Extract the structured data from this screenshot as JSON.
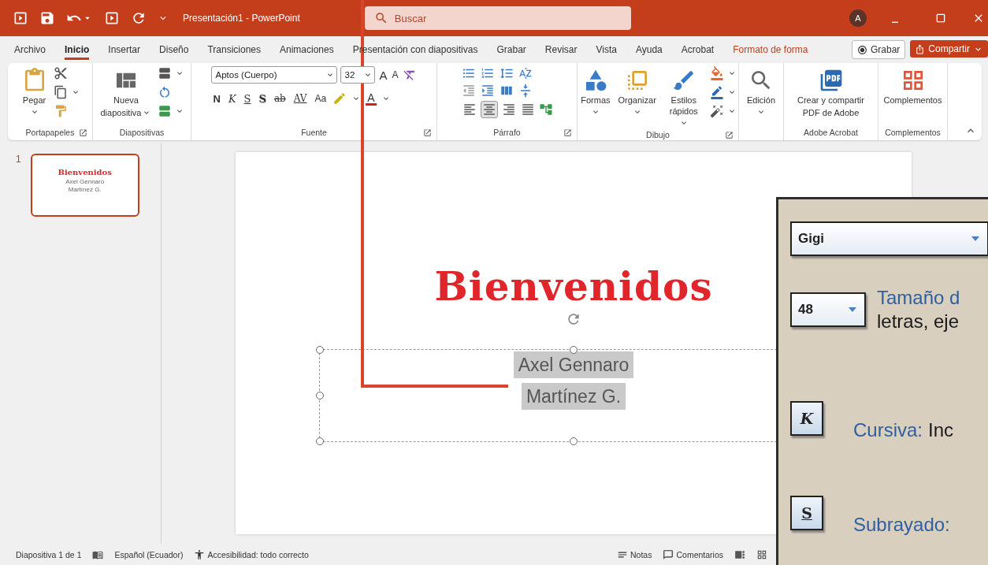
{
  "title_bar": {
    "title": "Presentación1 - PowerPoint",
    "search": {
      "placeholder": "Buscar"
    },
    "avatar": "A"
  },
  "menu_tabs": [
    {
      "label": "Archivo",
      "selected": false,
      "contextual": false
    },
    {
      "label": "Inicio",
      "selected": true,
      "contextual": false
    },
    {
      "label": "Insertar",
      "selected": false,
      "contextual": false
    },
    {
      "label": "Diseño",
      "selected": false,
      "contextual": false
    },
    {
      "label": "Transiciones",
      "selected": false,
      "contextual": false
    },
    {
      "label": "Animaciones",
      "selected": false,
      "contextual": false
    },
    {
      "label": "Presentación con diapositivas",
      "selected": false,
      "contextual": false
    },
    {
      "label": "Grabar",
      "selected": false,
      "contextual": false
    },
    {
      "label": "Revisar",
      "selected": false,
      "contextual": false
    },
    {
      "label": "Vista",
      "selected": false,
      "contextual": false
    },
    {
      "label": "Ayuda",
      "selected": false,
      "contextual": false
    },
    {
      "label": "Acrobat",
      "selected": false,
      "contextual": false
    },
    {
      "label": "Formato de forma",
      "selected": false,
      "contextual": true
    }
  ],
  "tab_actions": [
    {
      "kind": "outline",
      "label": "Grabar"
    },
    {
      "kind": "primary",
      "label": "Compartir"
    }
  ],
  "ribbon": [
    {
      "kind": "clipboard",
      "label": "Portapapeles",
      "launcher": true,
      "button": "Pegar"
    },
    {
      "kind": "slides",
      "label": "Diapositivas",
      "button_lines": [
        "Nueva",
        "diapositiva"
      ]
    },
    {
      "kind": "font",
      "label": "Fuente",
      "launcher": true,
      "font": "Aptos (Cuerpo)",
      "size": "32",
      "grow": "A",
      "shrink": "A",
      "format_buttons": [
        "N",
        "K",
        "S",
        "S",
        "ab",
        "AV",
        "Aa"
      ],
      "color_button": "A"
    },
    {
      "kind": "paragraph",
      "label": "Párrafo",
      "launcher": true,
      "align_buttons": [
        {
          "selected": false
        },
        {
          "selected": true
        },
        {
          "selected": false
        },
        {
          "selected": false
        }
      ]
    },
    {
      "kind": "drawing",
      "label": "Dibujo",
      "launcher": true,
      "buttons": [
        "Formas",
        "Organizar",
        "Estilos rápidos"
      ]
    },
    {
      "kind": "editing",
      "button": "Edición"
    },
    {
      "kind": "acrobat",
      "label": "Adobe Acrobat",
      "button_lines": [
        "Crear y compartir",
        "PDF de Adobe"
      ]
    },
    {
      "kind": "addins",
      "label": "Complementos",
      "button": "Complementos"
    }
  ],
  "thumbnails": [
    {
      "number": "1",
      "selected": true,
      "title": "Bienvenidos",
      "subtitle_lines": [
        "Axel Gennaro",
        "Martínez G."
      ]
    }
  ],
  "slide": {
    "title": "Bienvenidos",
    "subtitle": {
      "lines": [
        "Axel Gennaro",
        "Martínez G."
      ],
      "selected": true,
      "text_highlighted": true
    }
  },
  "status_bar": {
    "slide": "Diapositiva 1 de 1",
    "language": "Español (Ecuador)",
    "accessibility": "Accesibilidad: todo correcto",
    "notes": "Notas",
    "comments": "Comentarios"
  },
  "overlay_panel": {
    "rows": [
      {
        "kind": "font_box",
        "value": "Gigi"
      },
      {
        "kind": "size_box",
        "value": "48",
        "term": "Tamaño d",
        "desc": "letras, eje"
      },
      {
        "kind": "italic_button",
        "glyph": "K",
        "term": "Cursiva:",
        "desc": "Inc"
      },
      {
        "kind": "underline_button",
        "glyph": "S",
        "term": "Subrayado:"
      }
    ]
  }
}
